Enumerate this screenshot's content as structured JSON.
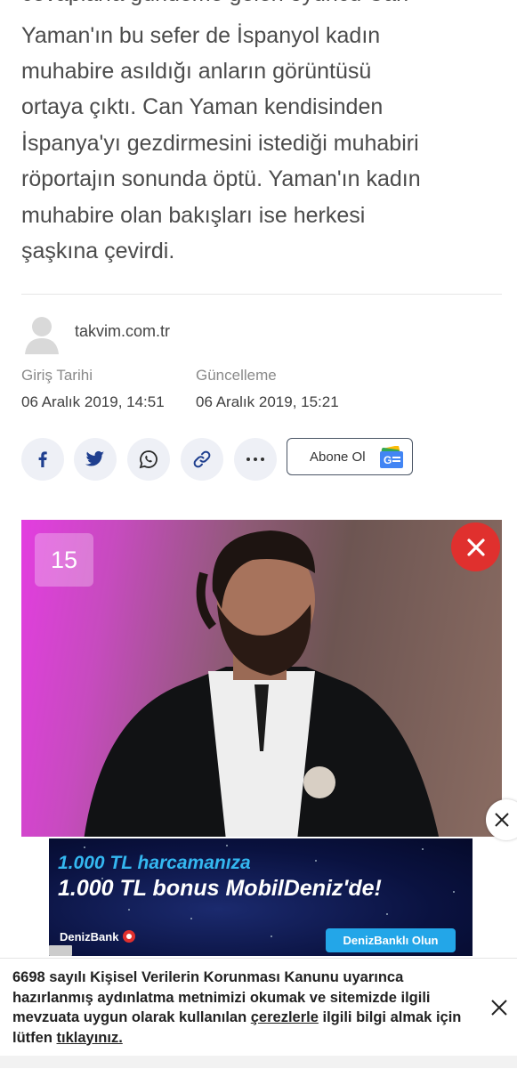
{
  "article": {
    "lines": [
      "cevaplarıa gündeme gelen oyuncu Can",
      "Yaman'ın bu sefer de İspanyol kadın",
      "muhabire asıldığı anların görüntüsü",
      "ortaya çıktı. Can Yaman kendisinden",
      "İspanya'yı gezdirmesini istediği muhabiri",
      "röportajın sonunda öptü. Yaman'ın kadın",
      "muhabire olan bakışları ise herkesi",
      "şaşkına çevirdi."
    ]
  },
  "author": {
    "name": "takvim.com.tr",
    "avatar_icon": "user-silhouette-icon"
  },
  "meta": {
    "published_label": "Giriş Tarihi",
    "published_value": "06 Aralık 2019, 14:51",
    "updated_label": "Güncelleme",
    "updated_value": "06 Aralık 2019, 15:21"
  },
  "share": {
    "buttons": [
      "facebook-icon",
      "twitter-icon",
      "whatsapp-icon",
      "link-icon",
      "more-icon"
    ],
    "subscribe_label": "Abone Ol",
    "subscribe_icon": "google-news-icon"
  },
  "gallery": {
    "counter": "15"
  },
  "ad": {
    "line1": "1.000 TL harcamanıza",
    "line2": "1.000 TL bonus MobilDeniz'de!",
    "brand": "DenizBank",
    "cta": "DenizBanklı Olun"
  },
  "cookie": {
    "text_before": "6698 sayılı Kişisel Verilerin Korunması Kanunu uyarınca hazırlanmış aydınlatma metnimizi okumak ve sitemizde ilgili mevzuata uygun olarak kullanılan ",
    "link1": "çerezlerle",
    "text_middle": " ilgili bilgi almak için lütfen ",
    "link2": "tıklayınız."
  },
  "colors": {
    "close_red": "#e0302e",
    "ad_blue": "#23a6e8",
    "twitter": "#1d9bf0",
    "facebook": "#1877f2"
  }
}
